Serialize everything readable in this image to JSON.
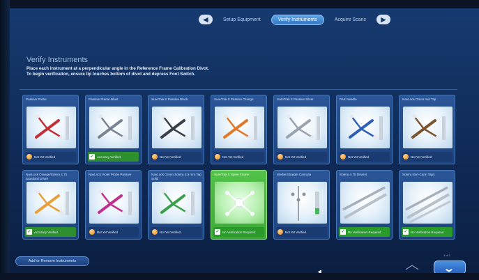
{
  "nav": {
    "back_icon": "left-arrow-icon",
    "forward_icon": "right-arrow-icon",
    "steps": [
      {
        "label": "Setup Equipment",
        "active": false
      },
      {
        "label": "Verify Instruments",
        "active": true
      },
      {
        "label": "Acquire Scans",
        "active": false
      }
    ]
  },
  "header": {
    "title": "Verify Instruments",
    "instructions_line1": "Place each instrument at a perpendicular angle in the Reference Frame Calibration Divot.",
    "instructions_line2": "To begin verification, ensure tip touches bottom of divot and depress Foot Switch."
  },
  "instruments": [
    {
      "label": "Passive Probe",
      "status": "Not Yet Verified",
      "state": "pending",
      "tool": "probe-red"
    },
    {
      "label": "Passive Planar Blunt",
      "status": "Accuracy Verified",
      "state": "ok",
      "tool": "planar-gray"
    },
    {
      "label": "SureTrak II Passive Black",
      "status": "Not Yet Verified",
      "state": "pending",
      "tool": "tracker-black"
    },
    {
      "label": "SureTrak II Passive Orange",
      "status": "Not Yet Verified",
      "state": "pending",
      "tool": "tracker-orange"
    },
    {
      "label": "SureTrak II Passive Silver",
      "status": "Not Yet Verified",
      "state": "pending",
      "tool": "tracker-silver"
    },
    {
      "label": "PAK Needle",
      "status": "Not Yet Verified",
      "state": "pending",
      "tool": "needle-blue"
    },
    {
      "label": "NavLock Driver Awl Tap",
      "status": "Not Yet Verified",
      "state": "pending",
      "tool": "navlock-brown"
    },
    {
      "label": "NavLock Orange/Solera 4.75 Standard Driver",
      "status": "Accuracy Verified",
      "state": "ok",
      "tool": "navlock-orange"
    },
    {
      "label": "NavLock Violet Probe Passive",
      "status": "Not Yet Verified",
      "state": "pending",
      "tool": "navlock-violet"
    },
    {
      "label": "NavLock Green Solera 4.5 mm Tap Solid",
      "status": "Not Yet Verified",
      "state": "pending",
      "tool": "navlock-green"
    },
    {
      "label": "SureTrak II Spine Frame",
      "status": "No Verification Required",
      "state": "noverify",
      "tool": "spine-frame",
      "highlight": true
    },
    {
      "label": "Medial Straight Cannula",
      "status": "Not Yet Verified",
      "state": "pending",
      "tool": "cannula"
    },
    {
      "label": "Solera 4.75 Drivers",
      "status": "No Verification Required",
      "state": "noverify",
      "tool": "drivers"
    },
    {
      "label": "Solera Non-Cann Taps",
      "status": "No Verification Required",
      "state": "noverify",
      "tool": "taps"
    }
  ],
  "footer": {
    "add_button": "Add or Remove Instruments",
    "page_indicator": "1 of 1",
    "scroll_up_icon": "chevron-up-icon",
    "scroll_down_icon": "chevron-down-icon"
  },
  "colors": {
    "accent": "#3576c2",
    "verified": "#2d8f2d",
    "pending_dot": "#e58a1c",
    "highlight_card": "#52c24a"
  }
}
